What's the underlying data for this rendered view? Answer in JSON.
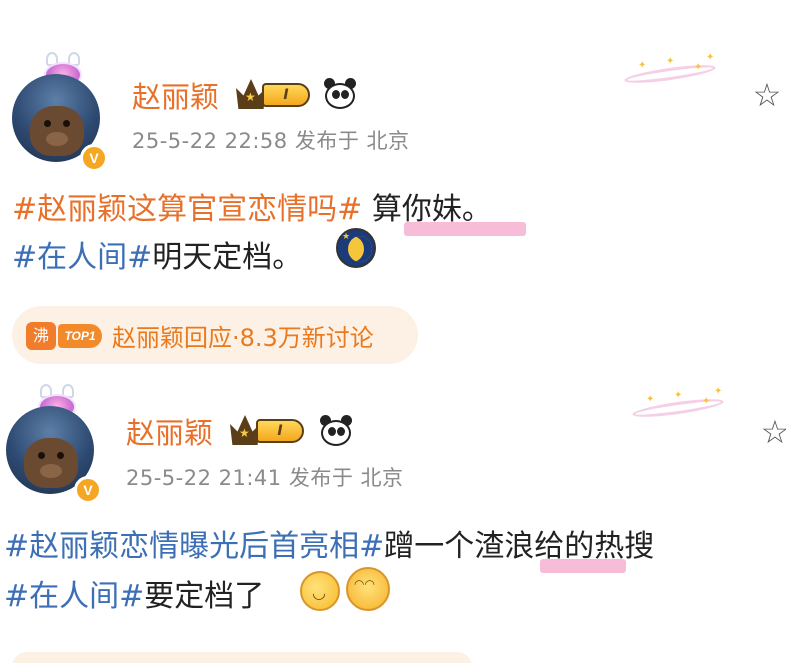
{
  "posts": [
    {
      "username": "赵丽颖",
      "level": "I",
      "timestamp": "25-5-22 22:58",
      "location_text": "发布于 北京",
      "line1_tag": "#赵丽颖这算官宣恋情吗#",
      "line1_text": " 算你妹。",
      "line2_tag": "#在人间#",
      "line2_text": "明天定档。",
      "emoji": "moon-sleep-emoji",
      "hot_search": {
        "icon_text": "沸",
        "rank": "TOP1",
        "text": "赵丽颖回应·8.3万新讨论"
      }
    },
    {
      "username": "赵丽颖",
      "level": "I",
      "timestamp": "25-5-22 21:41",
      "location_text": "发布于 北京",
      "line1_tag": "#赵丽颖恋情曝光后首亮相#",
      "line1_text": "蹭一个渣浪给的热搜",
      "line2_tag": "#在人间#",
      "line2_text": "要定档了",
      "emoji": "laugh-emoji"
    }
  ],
  "icons": {
    "vip_badge": "v-badge-icon",
    "crown": "crown-level-icon",
    "panda": "panda-icon",
    "favorite": "star-outline-icon",
    "decor": "sparkle-ring-icon"
  },
  "colors": {
    "name": "#e8702a",
    "topic_orange": "#e8702a",
    "topic_blue": "#3c6fb6",
    "meta": "#8a8a8a",
    "highlight": "#f6b6d4",
    "hot_bg": "#fdf0e4"
  }
}
